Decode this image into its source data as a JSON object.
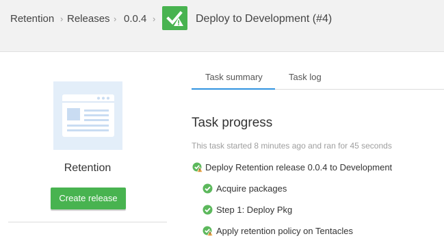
{
  "breadcrumb": {
    "items": [
      "Retention",
      "Releases",
      "0.0.4"
    ],
    "separator": "›"
  },
  "header": {
    "title": "Deploy to Development (#4)",
    "status_icon": "deploy-success-warning-icon"
  },
  "project": {
    "name": "Retention",
    "thumbnail_icon": "project-logo-icon",
    "create_release_label": "Create release"
  },
  "tabs": [
    {
      "label": "Task summary",
      "active": true
    },
    {
      "label": "Task log",
      "active": false
    }
  ],
  "task": {
    "heading": "Task progress",
    "meta": "This task started 8 minutes ago and ran for 45 seconds",
    "steps": [
      {
        "label": "Deploy Retention release 0.0.4 to Development",
        "status": "success-with-warning"
      },
      {
        "label": "Acquire packages",
        "status": "success"
      },
      {
        "label": "Step 1: Deploy Pkg",
        "status": "success"
      },
      {
        "label": "Apply retention policy on Tentacles",
        "status": "success-with-warning"
      }
    ]
  },
  "colors": {
    "accent_green": "#48b350",
    "success_green": "#5cb85c",
    "warning_yellow": "#f0ad4e",
    "tab_active_blue": "#2f93e0",
    "header_bg": "#f2f2f2",
    "thumbnail_bg": "#e3eef9"
  }
}
